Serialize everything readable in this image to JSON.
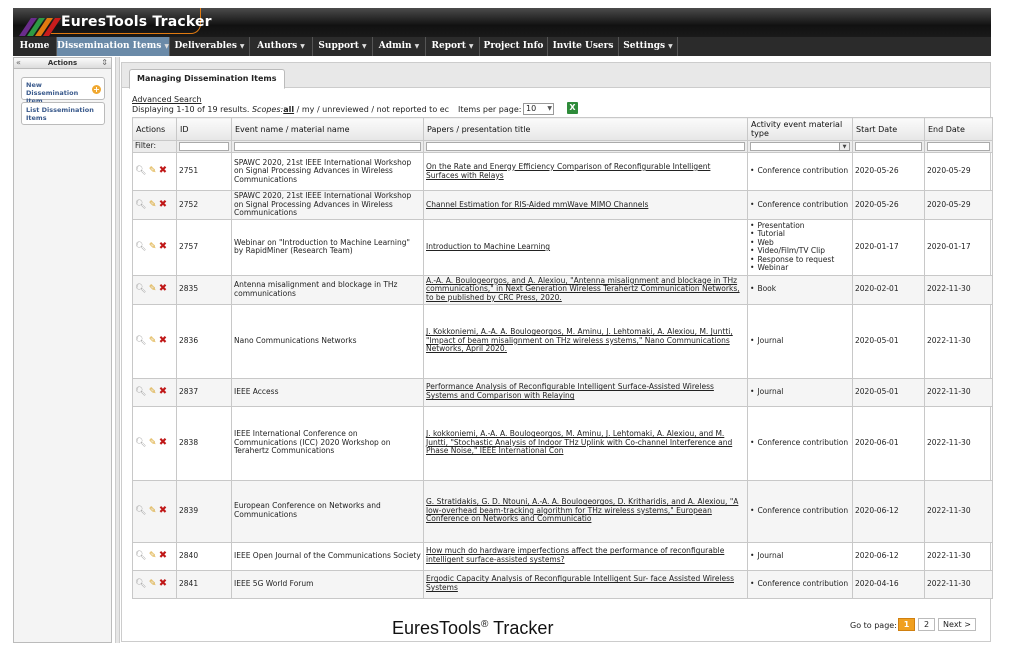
{
  "app": {
    "title": "EuresTools Tracker"
  },
  "nav": [
    {
      "label": "Home",
      "caret": false,
      "active": false
    },
    {
      "label": "Dissemination Items",
      "caret": true,
      "active": true
    },
    {
      "label": "Deliverables",
      "caret": true,
      "active": false
    },
    {
      "label": "Authors",
      "caret": true,
      "active": false
    },
    {
      "label": "Support",
      "caret": true,
      "active": false
    },
    {
      "label": "Admin",
      "caret": true,
      "active": false
    },
    {
      "label": "Report",
      "caret": true,
      "active": false
    },
    {
      "label": "Project Info",
      "caret": false,
      "active": false
    },
    {
      "label": "Invite Users",
      "caret": false,
      "active": false
    },
    {
      "label": "Settings",
      "caret": true,
      "active": false
    }
  ],
  "sidebar": {
    "title": "Actions",
    "collapse": "«",
    "items": [
      {
        "label": "New Dissemination Item"
      },
      {
        "label": "List Dissemination Items"
      }
    ]
  },
  "tab": {
    "label": "Managing Dissemination Items"
  },
  "search": {
    "advanced": "Advanced Search",
    "results_prefix": "Displaying 1-10 of 19 results.",
    "scopes_label": "Scopes:",
    "scope_all": "all",
    "scope_rest": " / my / unreviewed / not reported to ec",
    "per_page_label": "Items per page:",
    "per_page_value": "10"
  },
  "table": {
    "filter_label": "Filter:",
    "columns": [
      "Actions",
      "ID",
      "Event name / material name",
      "Papers / presentation title",
      "Activity event material type",
      "Start Date",
      "End Date"
    ],
    "rows": [
      {
        "id": "2751",
        "event": "SPAWC 2020, 21st IEEE International Workshop on Signal Processing Advances in Wireless Communications",
        "paper": "On the Rate and Energy Efficiency Comparison of Reconfigurable Intelligent Surfaces with Relays",
        "types": [
          "Conference contribution"
        ],
        "start": "2020-05-26",
        "end": "2020-05-29"
      },
      {
        "id": "2752",
        "event": "SPAWC 2020, 21st IEEE International Workshop on Signal Processing Advances in Wireless Communications",
        "paper": "Channel Estimation for RIS-Aided mmWave MIMO Channels",
        "types": [
          "Conference contribution"
        ],
        "start": "2020-05-26",
        "end": "2020-05-29"
      },
      {
        "id": "2757",
        "event": "Webinar on \"Introduction to Machine Learning\" by RapidMiner (Research Team)",
        "paper": "Introduction to Machine Learning",
        "types": [
          "Presentation",
          "Tutorial",
          "Web",
          "Video/Film/TV Clip",
          "Response to request",
          "Webinar"
        ],
        "start": "2020-01-17",
        "end": "2020-01-17"
      },
      {
        "id": "2835",
        "event": "Antenna misalignment and blockage in THz communications",
        "paper": "A.-A. A. Boulogeorgos, and A. Alexiou, \"Antenna misalignment and blockage in THz communications,\" in Next Generation Wireless Terahertz Communication Networks, to be published by CRC Press, 2020.",
        "types": [
          "Book"
        ],
        "start": "2020-02-01",
        "end": "2022-11-30"
      },
      {
        "id": "2836",
        "event": "Nano Communications Networks",
        "paper": "J. Kokkoniemi, A.-A. A. Boulogeorgos, M. Aminu, J. Lehtomaki, A. Alexiou, M. Juntti, \"Impact of beam misalignment on THz wireless systems,\" Nano Communications Networks, April 2020.",
        "types": [
          "Journal"
        ],
        "start": "2020-05-01",
        "end": "2022-11-30"
      },
      {
        "id": "2837",
        "event": "IEEE Access",
        "paper": "Performance Analysis of Reconfigurable Intelligent Surface-Assisted Wireless Systems and Comparison with Relaying",
        "types": [
          "Journal"
        ],
        "start": "2020-05-01",
        "end": "2022-11-30"
      },
      {
        "id": "2838",
        "event": "IEEE International Conference on Communications (ICC) 2020 Workshop on Terahertz Communications",
        "paper": "J. kokkoniemi, A.-A. A. Boulogeorgos, M. Aminu, J. Lehtomaki, A. Alexiou, and M. Juntti, \"Stochastic Analysis of Indoor THz Uplink with Co-channel Interference and Phase Noise,\" IEEE International Con",
        "types": [
          "Conference contribution"
        ],
        "start": "2020-06-01",
        "end": "2022-11-30"
      },
      {
        "id": "2839",
        "event": "European Conference on Networks and Communications",
        "paper": "G. Stratidakis, G. D. Ntouni, A.-A. A. Boulogeorgos, D. Kritharidis, and A. Alexiou, \"A low-overhead beam-tracking algorithm for THz wireless systems,\" European Conference on Networks and Communicatio",
        "types": [
          "Conference contribution"
        ],
        "start": "2020-06-12",
        "end": "2022-11-30"
      },
      {
        "id": "2840",
        "event": "IEEE Open Journal of the Communications Society",
        "paper": "How much do hardware imperfections affect the performance of reconfigurable intelligent surface-assisted systems?",
        "types": [
          "Journal"
        ],
        "start": "2020-06-12",
        "end": "2022-11-30"
      },
      {
        "id": "2841",
        "event": "IEEE 5G World Forum",
        "paper": "Ergodic Capacity Analysis of Reconfigurable Intelligent Sur- face Assisted Wireless Systems",
        "types": [
          "Conference contribution"
        ],
        "start": "2020-04-16",
        "end": "2022-11-30"
      }
    ]
  },
  "pagination": {
    "label": "Go to page:",
    "pages": [
      "1",
      "2"
    ],
    "current": "1",
    "next": "Next >"
  },
  "caption": {
    "text": "EuresTools",
    "reg": "®",
    "suffix": " Tracker"
  },
  "colors": {
    "nav_active": "#6a8aa8",
    "accent_orange": "#f0a020",
    "delete_red": "#c01818",
    "header_dark": "#1a1a1a"
  }
}
